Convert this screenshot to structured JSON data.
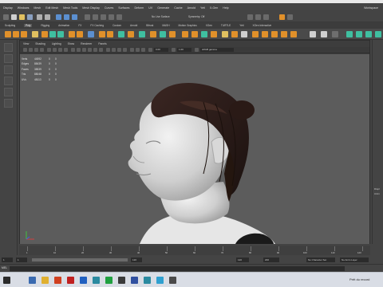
{
  "window": {
    "title": ""
  },
  "menubar": {
    "items": [
      "Display",
      "Windows",
      "Mesh",
      "Edit Mesh",
      "Mesh Tools",
      "Mesh Display",
      "Curves",
      "Surfaces",
      "Deform",
      "UV",
      "Generate",
      "Cache",
      "Arnold",
      "Yeti",
      "X-Gen",
      "Help"
    ],
    "workspace_label": "Workspace"
  },
  "statusline": {
    "live_surface": "No Live Surface",
    "symmetry": "Symmetry: Off"
  },
  "shelf_tabs": [
    "Sculpting",
    "Poly",
    "Rigging",
    "Animation",
    "FX",
    "FX Caching",
    "Custom",
    "Arnold",
    "Bifrost",
    "MASH",
    "Motion Graphics",
    "XGen",
    "TURTLE",
    "Yeti",
    "XGen Interactive"
  ],
  "shelf_active_tab": "Poly",
  "viewport": {
    "menus": [
      "View",
      "Shading",
      "Lighting",
      "Show",
      "Renderer",
      "Panels"
    ],
    "gamma_value": "0.00",
    "exposure_value": "1.00",
    "colorspace": "sRGB gamma"
  },
  "hud": {
    "headers": [
      "",
      "",
      "",
      ""
    ],
    "rows": [
      {
        "label": "Verts",
        "v1": "44592",
        "v2": "0",
        "v3": "0"
      },
      {
        "label": "Edges",
        "v1": "88439",
        "v2": "0",
        "v3": "0"
      },
      {
        "label": "Faces",
        "v1": "38539",
        "v2": "0",
        "v3": "0"
      },
      {
        "label": "Tris",
        "v1": "88048",
        "v2": "0",
        "v3": "0"
      },
      {
        "label": "UVs",
        "v1": "48113",
        "v2": "0",
        "v3": "0"
      }
    ]
  },
  "right_panel": {
    "label_1": "Displ",
    "label_2": "Anim"
  },
  "timeslider": {
    "labels": [
      "1",
      "10",
      "20",
      "30",
      "40",
      "50",
      "60",
      "70",
      "80",
      "90",
      "100",
      "110",
      "120"
    ]
  },
  "range": {
    "start": "1",
    "start_inner": "1",
    "end_inner": "120",
    "end": "120",
    "end_outer": "200",
    "char_set": "No Character Set",
    "anim_layer": "No Anim Layer"
  },
  "mel": {
    "label": "MEL"
  },
  "taskbar": {
    "notification": "Prêt du record"
  },
  "colors": {
    "accent_orange": "#e0902a",
    "accent_teal": "#3fbfa0",
    "taskbar_bg": "#d9dde5"
  }
}
